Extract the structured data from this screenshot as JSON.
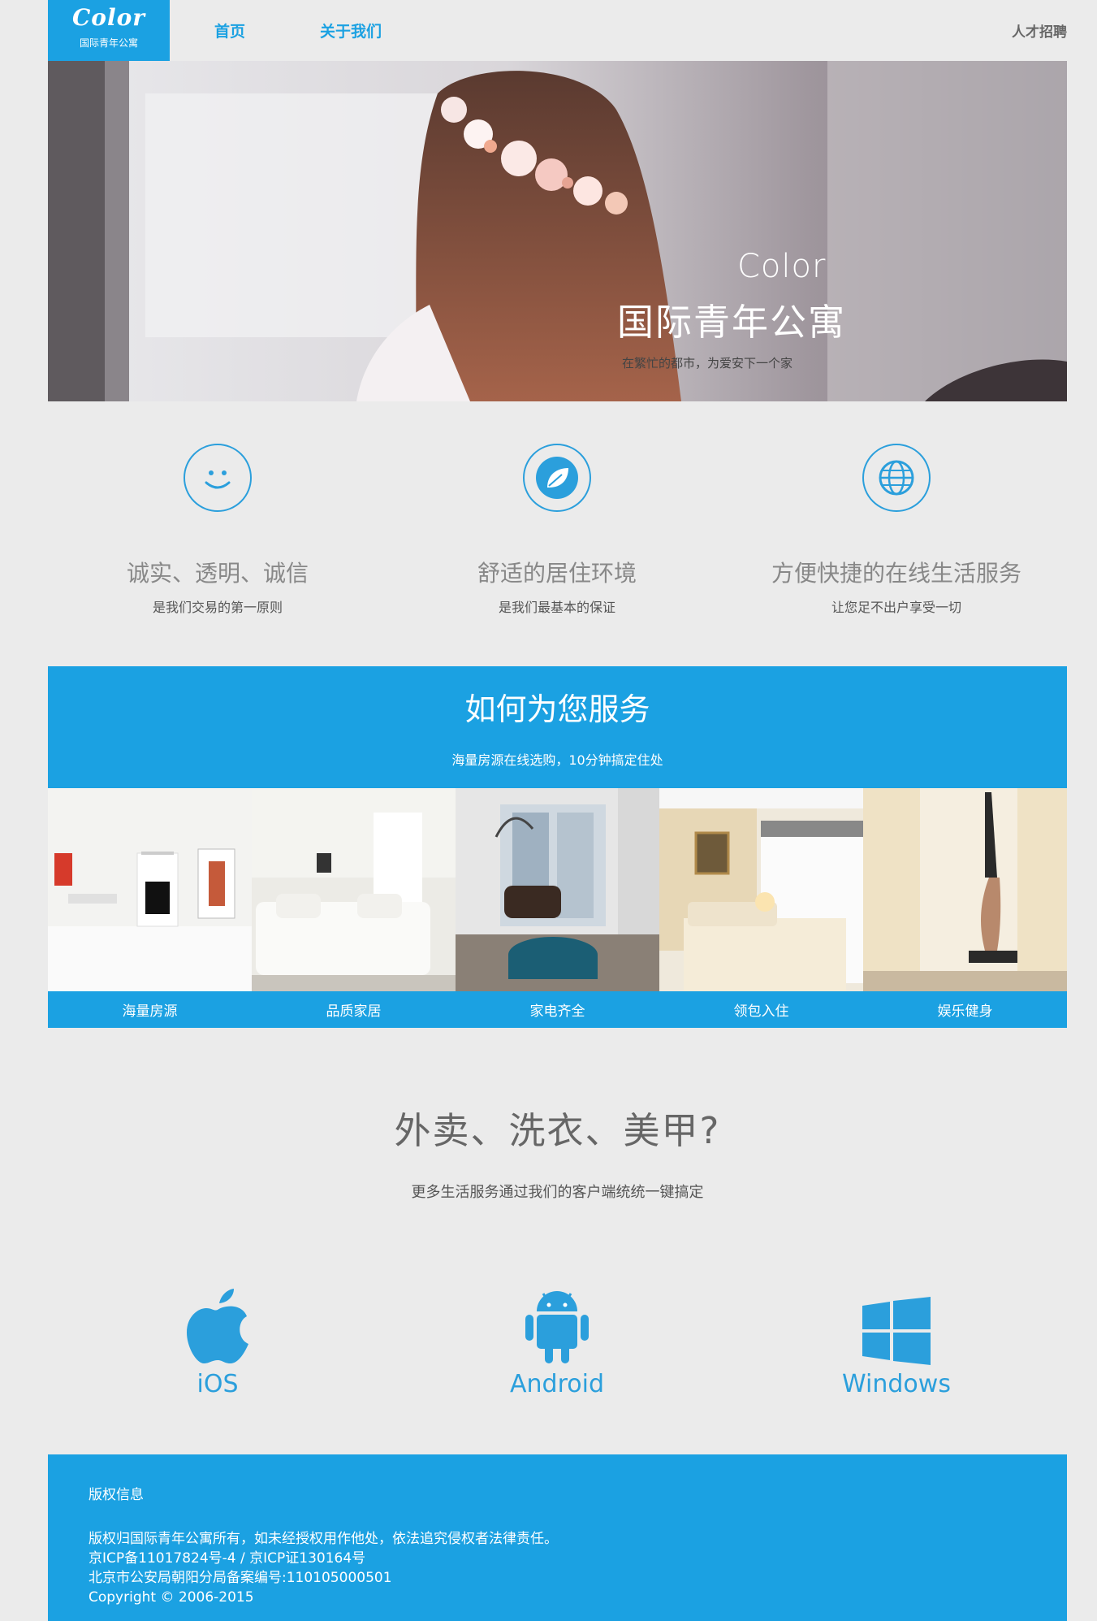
{
  "header": {
    "logo_script": "Color",
    "logo_sub": "国际青年公寓",
    "nav": [
      {
        "label": "首页"
      },
      {
        "label": "关于我们"
      }
    ],
    "jobs_label": "人才招聘",
    "accent": "#1ba1e2"
  },
  "hero": {
    "title_en": "Color",
    "title_cn": "国际青年公寓",
    "tagline": "在繁忙的都市，为爱安下一个家"
  },
  "features": [
    {
      "icon": "smiley-icon",
      "title": "诚实、透明、诚信",
      "desc": "是我们交易的第一原则"
    },
    {
      "icon": "leaf-icon",
      "title": "舒适的居住环境",
      "desc": "是我们最基本的保证"
    },
    {
      "icon": "globe-icon",
      "title": "方便快捷的在线生活服务",
      "desc": "让您足不出户享受一切"
    }
  ],
  "service": {
    "title": "如何为您服务",
    "subtitle": "海量房源在线选购，10分钟搞定住处",
    "tiles": [
      {
        "caption": "海量房源"
      },
      {
        "caption": "品质家居"
      },
      {
        "caption": "家电齐全"
      },
      {
        "caption": "领包入住"
      },
      {
        "caption": "娱乐健身"
      }
    ]
  },
  "more": {
    "question": "外卖、洗衣、美甲?",
    "desc": "更多生活服务通过我们的客户端统统一键搞定",
    "platforms": [
      {
        "icon": "apple-icon",
        "label": "iOS"
      },
      {
        "icon": "android-icon",
        "label": "Android"
      },
      {
        "icon": "windows-icon",
        "label": "Windows"
      }
    ]
  },
  "footer": {
    "title": "版权信息",
    "lines": [
      "版权归国际青年公寓所有，如未经授权用作他处，依法追究侵权者法律责任。",
      "京ICP备11017824号-4 / 京ICP证130164号",
      "北京市公安局朝阳分局备案编号:110105000501",
      "Copyright © 2006-2015"
    ]
  }
}
